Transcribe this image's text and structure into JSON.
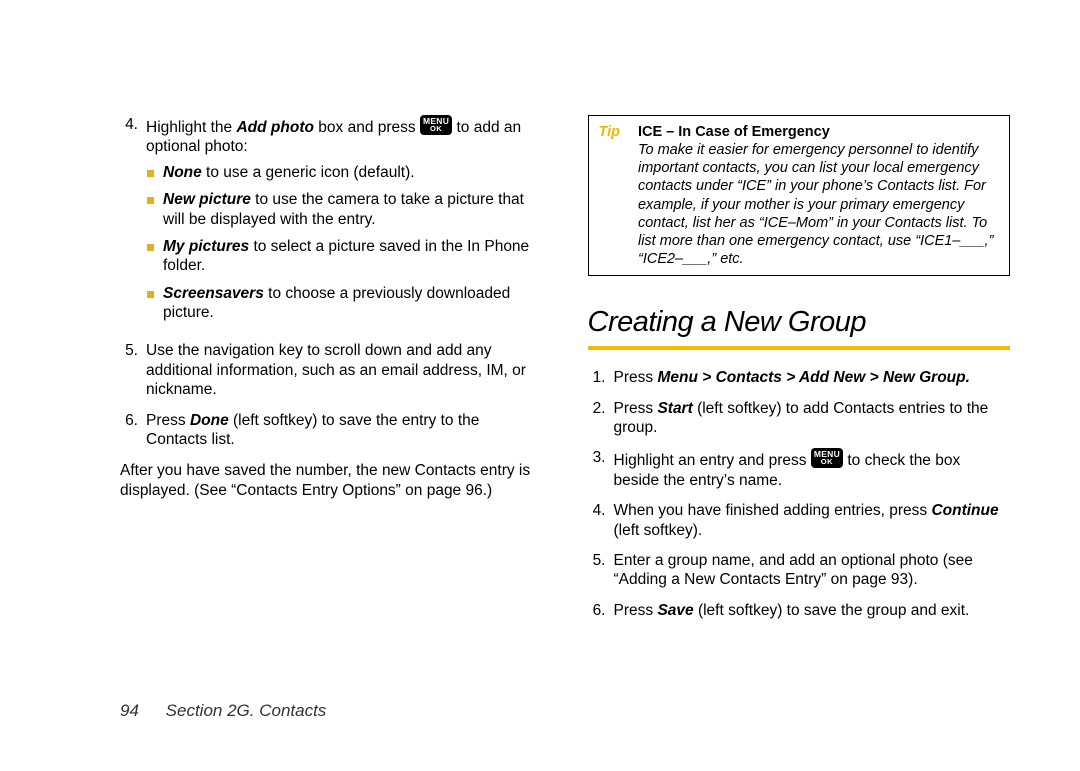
{
  "menu_key": {
    "top": "MENU",
    "bot": "OK"
  },
  "left": {
    "step4": {
      "num": "4.",
      "pre": "Highlight the ",
      "addphoto": "Add photo",
      "mid": " box and press ",
      "post": " to add an optional photo:",
      "sub": {
        "none_b": "None",
        "none_t": " to use a generic icon (default).",
        "newpic_b": "New picture",
        "newpic_t": " to use the camera to take a picture that will be displayed with the entry.",
        "mypic_b": "My pictures",
        "mypic_t": " to select a picture saved in the In Phone folder.",
        "ss_b": "Screensavers",
        "ss_t": " to choose a previously downloaded picture."
      }
    },
    "step5": {
      "num": "5.",
      "text": "Use the navigation key to scroll down and add any additional information, such as an email address, IM, or nickname."
    },
    "step6": {
      "num": "6.",
      "pre": "Press ",
      "done": "Done",
      "post": " (left softkey) to save the entry to the Contacts list."
    },
    "after": "After you have saved the number, the new Contacts entry is displayed. (See “Contacts Entry Options” on page 96.)"
  },
  "right": {
    "tip": {
      "label": "Tip",
      "title": "ICE – In Case of Emergency",
      "body": "To make it easier for emergency personnel to identify important contacts, you can list your local emergency contacts under “ICE” in your phone’s Contacts list. For example, if your mother is your primary emergency contact, list her as “ICE–Mom” in your Contacts list. To list more than one emergency contact, use “ICE1–___,” “ICE2–___,” etc."
    },
    "heading": "Creating a New Group",
    "step1": {
      "num": "1.",
      "pre": "Press ",
      "path": "Menu > Contacts > Add New > New Group.",
      "post": ""
    },
    "step2": {
      "num": "2.",
      "pre": "Press ",
      "start": "Start",
      "post": " (left softkey) to add Contacts entries to the group."
    },
    "step3": {
      "num": "3.",
      "pre": "Highlight an entry and press ",
      "post": " to check the box beside the entry’s name."
    },
    "step4": {
      "num": "4.",
      "pre": "When you have finished adding entries, press ",
      "cont": "Continue",
      "post": " (left softkey)."
    },
    "step5": {
      "num": "5.",
      "text": "Enter a group name, and add an optional photo (see “Adding a New Contacts Entry” on page 93)."
    },
    "step6": {
      "num": "6.",
      "pre": "Press ",
      "save": "Save",
      "post": " (left softkey) to save the group and exit."
    }
  },
  "footer": {
    "page": "94",
    "section": "Section 2G. Contacts"
  }
}
